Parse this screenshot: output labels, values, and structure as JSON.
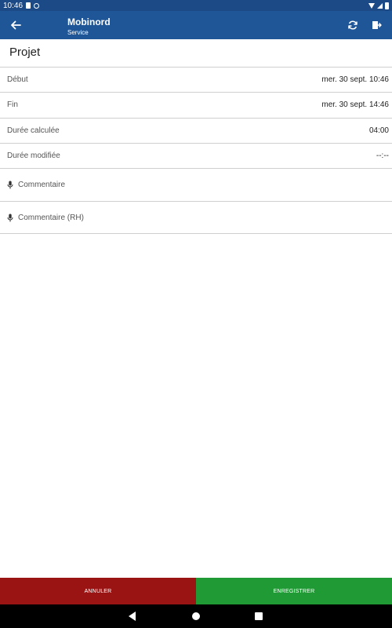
{
  "status_bar": {
    "time": "10:46",
    "icons": [
      "sd-card-icon",
      "sync-circle-icon",
      "wifi-icon",
      "signal-icon",
      "battery-icon"
    ]
  },
  "app_bar": {
    "title": "Mobinord",
    "subtitle": "Service",
    "icons": [
      "arrow-left-icon",
      "refresh-icon",
      "exit-icon"
    ]
  },
  "section": {
    "title": "Projet"
  },
  "fields": [
    {
      "label": "Début",
      "value": "mer. 30 sept. 10:46"
    },
    {
      "label": "Fin",
      "value": "mer. 30 sept. 14:46"
    },
    {
      "label": "Durée calculée",
      "value": "04:00"
    },
    {
      "label": "Durée modifiée",
      "value": "--:--"
    }
  ],
  "comments": [
    {
      "label": "Commentaire",
      "icon": "microphone-icon"
    },
    {
      "label": "Commentaire (RH)",
      "icon": "microphone-icon"
    }
  ],
  "actions": {
    "cancel_label": "ANNULER",
    "save_label": "ENREGISTRER"
  },
  "colors": {
    "status_bar": "#1b4a86",
    "app_bar": "#1f5697",
    "cancel": "#9b1414",
    "save": "#1f9a35",
    "nav_bar": "#000000"
  },
  "nav_bar": {
    "icons": [
      "nav-back-icon",
      "nav-home-icon",
      "nav-recents-icon"
    ]
  }
}
